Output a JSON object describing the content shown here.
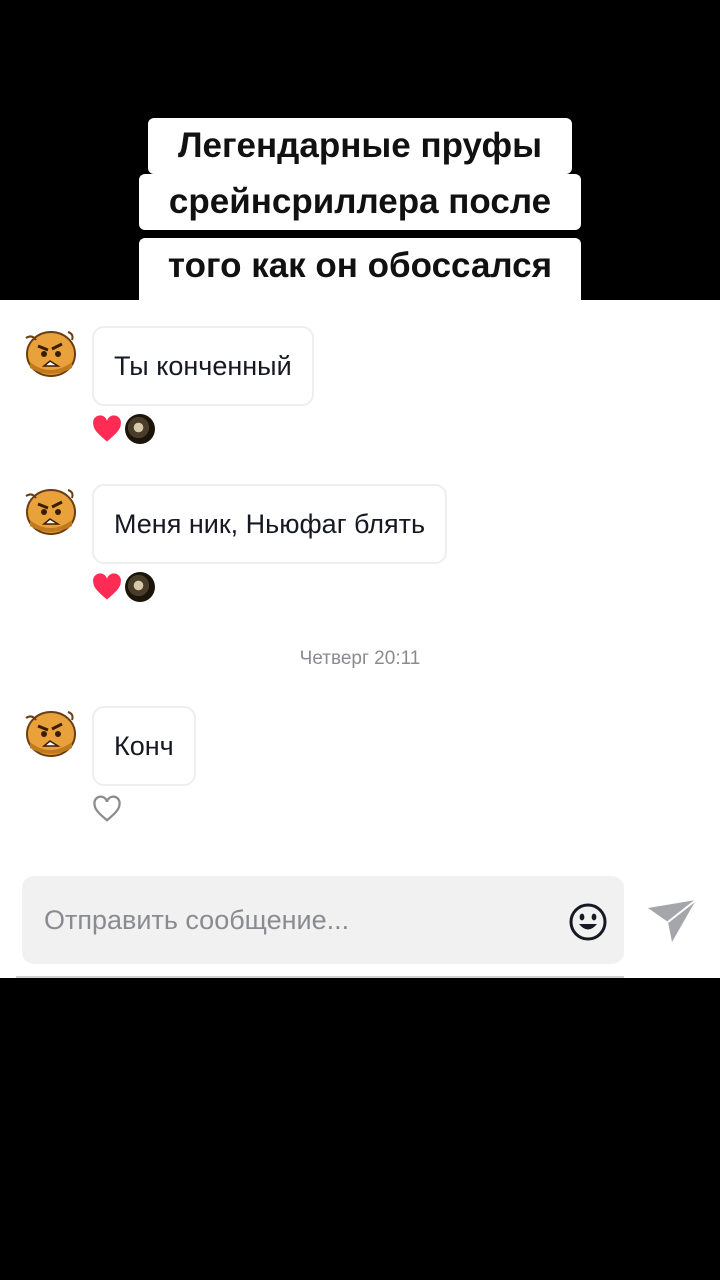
{
  "caption": {
    "line1": "Легендарные пруфы",
    "line2": "срейнсриллера после",
    "line3": "того как он обоссался"
  },
  "messages": [
    {
      "text": "Ты конченный",
      "liked": true
    },
    {
      "text": "Меня ник, Ньюфаг блять",
      "liked": true
    },
    {
      "text": "Конч",
      "liked": false
    }
  ],
  "timestamp": "Четверг 20:11",
  "input": {
    "placeholder": "Отправить сообщение..."
  },
  "icons": {
    "heart": "heart-icon",
    "heart_outline": "heart-outline-icon",
    "emoji": "emoji-icon",
    "send": "send-icon"
  },
  "colors": {
    "like": "#fe2c55",
    "text": "#161823",
    "muted": "#8a8b91"
  }
}
